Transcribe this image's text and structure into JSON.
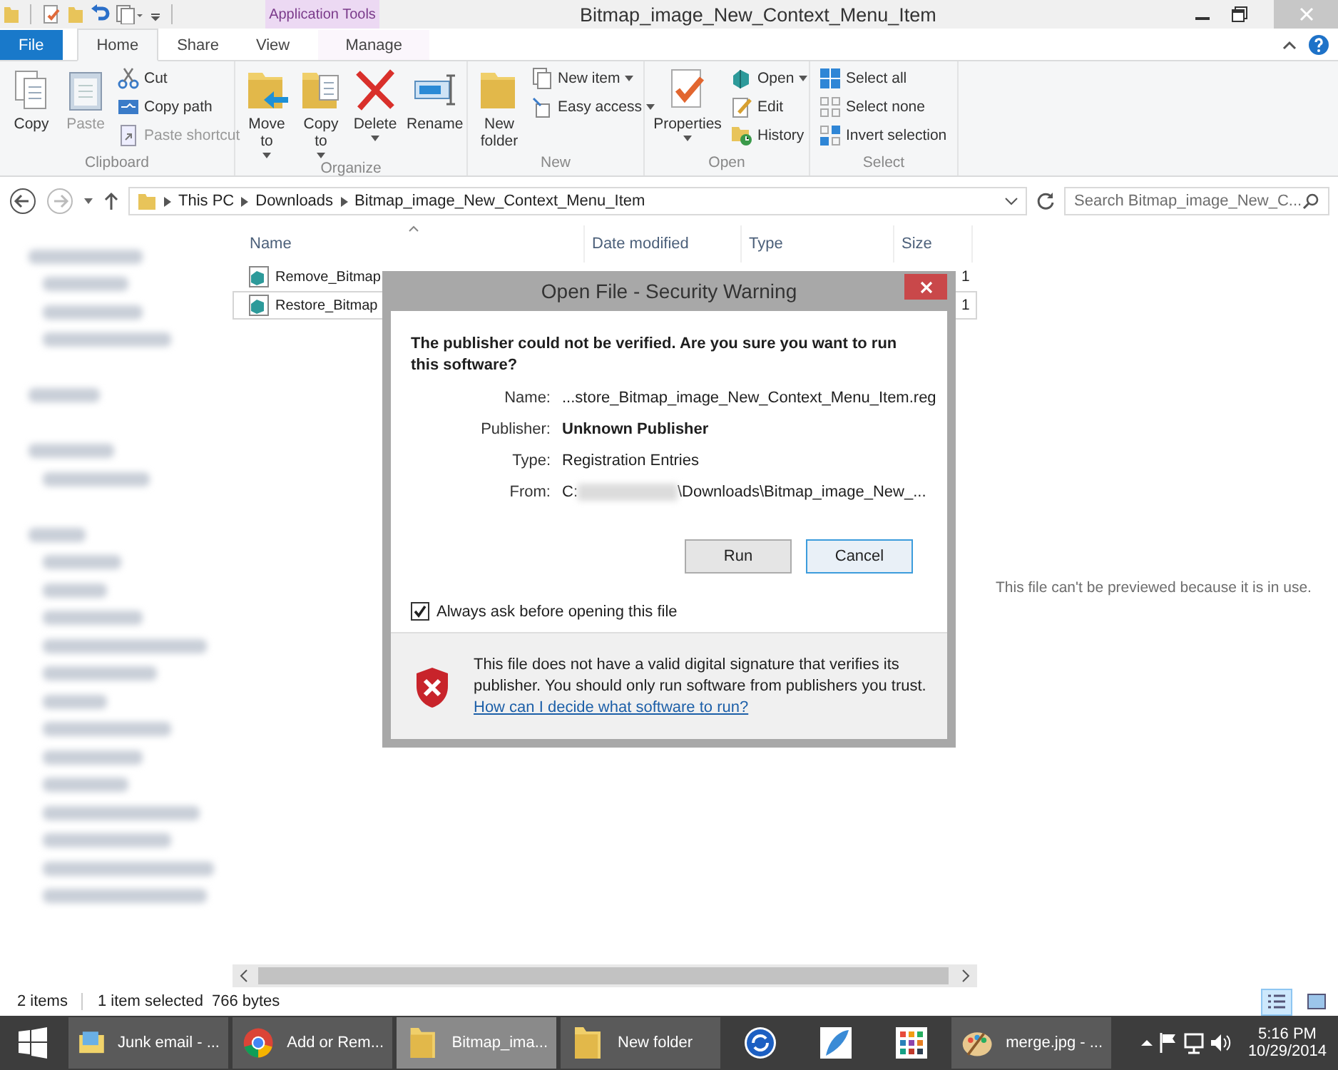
{
  "window": {
    "title": "Bitmap_image_New_Context_Menu_Item",
    "context_tab_group": "Application Tools"
  },
  "ribbon": {
    "tabs": [
      {
        "label": "File",
        "kind": "file",
        "selected": false
      },
      {
        "label": "Home",
        "kind": "normal",
        "selected": true
      },
      {
        "label": "Share",
        "kind": "normal",
        "selected": false
      },
      {
        "label": "View",
        "kind": "normal",
        "selected": false
      },
      {
        "label": "Manage",
        "kind": "context",
        "selected": false
      }
    ],
    "groups": [
      {
        "label": "Clipboard",
        "large": [
          {
            "label": "Copy",
            "disabled": false,
            "dropdown": false
          },
          {
            "label": "Paste",
            "disabled": true,
            "dropdown": false
          }
        ],
        "small": [
          {
            "label": "Cut",
            "disabled": false,
            "dropdown": false
          },
          {
            "label": "Copy path",
            "disabled": false,
            "dropdown": false
          },
          {
            "label": "Paste shortcut",
            "disabled": true,
            "dropdown": false
          }
        ]
      },
      {
        "label": "Organize",
        "large": [
          {
            "label": "Move to",
            "disabled": false,
            "dropdown": true
          },
          {
            "label": "Copy to",
            "disabled": false,
            "dropdown": true
          },
          {
            "label": "Delete",
            "disabled": false,
            "dropdown": true
          },
          {
            "label": "Rename",
            "disabled": false,
            "dropdown": false
          }
        ]
      },
      {
        "label": "New",
        "large": [
          {
            "label": "New folder",
            "disabled": false,
            "dropdown": false
          }
        ],
        "small": [
          {
            "label": "New item",
            "disabled": false,
            "dropdown": true
          },
          {
            "label": "Easy access",
            "disabled": false,
            "dropdown": true
          }
        ]
      },
      {
        "label": "Open",
        "large": [
          {
            "label": "Properties",
            "disabled": false,
            "dropdown": true
          }
        ],
        "small": [
          {
            "label": "Open",
            "disabled": false,
            "dropdown": true
          },
          {
            "label": "Edit",
            "disabled": false,
            "dropdown": false
          },
          {
            "label": "History",
            "disabled": false,
            "dropdown": false
          }
        ]
      },
      {
        "label": "Select",
        "small": [
          {
            "label": "Select all",
            "disabled": false,
            "dropdown": false
          },
          {
            "label": "Select none",
            "disabled": false,
            "dropdown": false
          },
          {
            "label": "Invert selection",
            "disabled": false,
            "dropdown": false
          }
        ]
      }
    ]
  },
  "address_bar": {
    "path": [
      "This PC",
      "Downloads",
      "Bitmap_image_New_Context_Menu_Item"
    ],
    "search_placeholder": "Search Bitmap_image_New_C..."
  },
  "file_list": {
    "columns": [
      {
        "label": "Name",
        "sorted": true
      },
      {
        "label": "Date modified",
        "sorted": false
      },
      {
        "label": "Type",
        "sorted": false
      },
      {
        "label": "Size",
        "sorted": false
      }
    ],
    "rows": [
      {
        "name": "Remove_Bitmap",
        "size": "1",
        "selected": false
      },
      {
        "name": "Restore_Bitmap",
        "size": "1",
        "selected": true
      }
    ]
  },
  "preview_pane": {
    "message": "This file can't be previewed because it is in use."
  },
  "dialog": {
    "title": "Open File - Security Warning",
    "question": "The publisher could not be verified.  Are you sure you want to run this software?",
    "fields": [
      {
        "label": "Name:",
        "value": "...store_Bitmap_image_New_Context_Menu_Item.reg",
        "kind": "plain"
      },
      {
        "label": "Publisher:",
        "value": "Unknown Publisher",
        "kind": "bold"
      },
      {
        "label": "Type:",
        "value": "Registration Entries",
        "kind": "plain"
      },
      {
        "label": "From:",
        "value": "C:",
        "value_end": "\\Downloads\\Bitmap_image_New_...",
        "kind": "redacted"
      }
    ],
    "buttons": [
      {
        "label": "Run",
        "focused": false
      },
      {
        "label": "Cancel",
        "focused": true
      }
    ],
    "checkbox": {
      "label": "Always ask before opening this file",
      "checked": true
    },
    "warning": {
      "text": "This file does not have a valid digital signature that verifies its publisher.  You should only run software from publishers you trust.",
      "link": "How can I decide what software to run?"
    }
  },
  "status_bar": {
    "item_count": "2 items",
    "selection": "1 item selected",
    "size": "766 bytes",
    "views": [
      {
        "selected": true
      },
      {
        "selected": false
      }
    ]
  },
  "taskbar": {
    "items": [
      {
        "label": "Junk email - ...",
        "selected": false
      },
      {
        "label": "Add or Rem...",
        "selected": false
      },
      {
        "label": "Bitmap_ima...",
        "selected": true
      },
      {
        "label": "New folder",
        "selected": false
      },
      {
        "selected": false
      },
      {
        "selected": false
      },
      {
        "selected": false
      },
      {
        "label": "merge.jpg - ...",
        "selected": false
      }
    ],
    "time": "5:16 PM",
    "date": "10/29/2014"
  }
}
